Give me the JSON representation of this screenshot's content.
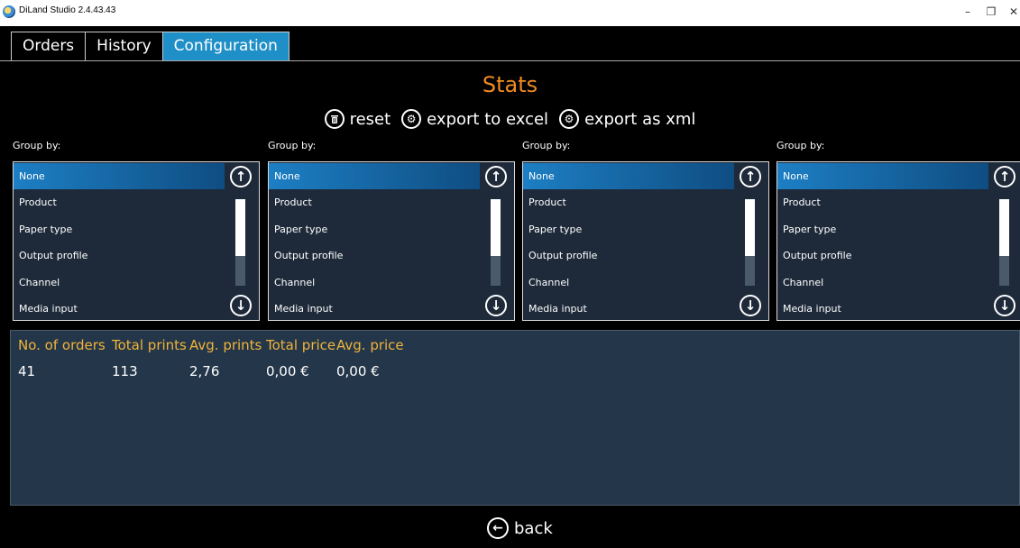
{
  "window": {
    "title": "DiLand Studio 2.4.43.43",
    "controls": {
      "minimize": "–",
      "maximize": "❐",
      "close": "✕"
    }
  },
  "tabs": [
    {
      "label": "Orders",
      "active": false
    },
    {
      "label": "History",
      "active": false
    },
    {
      "label": "Configuration",
      "active": true
    }
  ],
  "page": {
    "title": "Stats"
  },
  "toolbar": {
    "reset": {
      "label": "reset",
      "icon": "trash-icon"
    },
    "export_excel": {
      "label": "export to excel",
      "icon": "gear-icon"
    },
    "export_xml": {
      "label": "export as xml",
      "icon": "gear-icon"
    }
  },
  "group_by": [
    {
      "label": "Group by:",
      "selected": "None",
      "options": [
        "None",
        "Product",
        "Paper type",
        "Output profile",
        "Channel",
        "Media input"
      ]
    },
    {
      "label": "Group by:",
      "selected": "None",
      "options": [
        "None",
        "Product",
        "Paper type",
        "Output profile",
        "Channel",
        "Media input"
      ]
    },
    {
      "label": "Group by:",
      "selected": "None",
      "options": [
        "None",
        "Product",
        "Paper type",
        "Output profile",
        "Channel",
        "Media input"
      ]
    },
    {
      "label": "Group by:",
      "selected": "None",
      "options": [
        "None",
        "Product",
        "Paper type",
        "Output profile",
        "Channel",
        "Media input"
      ]
    }
  ],
  "results": {
    "columns": [
      "No. of orders",
      "Total prints",
      "Avg. prints",
      "Total price",
      "Avg. price"
    ],
    "rows": [
      [
        "41",
        "113",
        "2,76",
        "0,00 €",
        "0,00 €"
      ]
    ]
  },
  "footer": {
    "back_label": "back"
  },
  "colors": {
    "accent": "#f08a24",
    "header_text": "#f0b43a",
    "selection": "#1d7fc4",
    "active_tab": "#1f8fc7",
    "results_bg": "#243649"
  }
}
